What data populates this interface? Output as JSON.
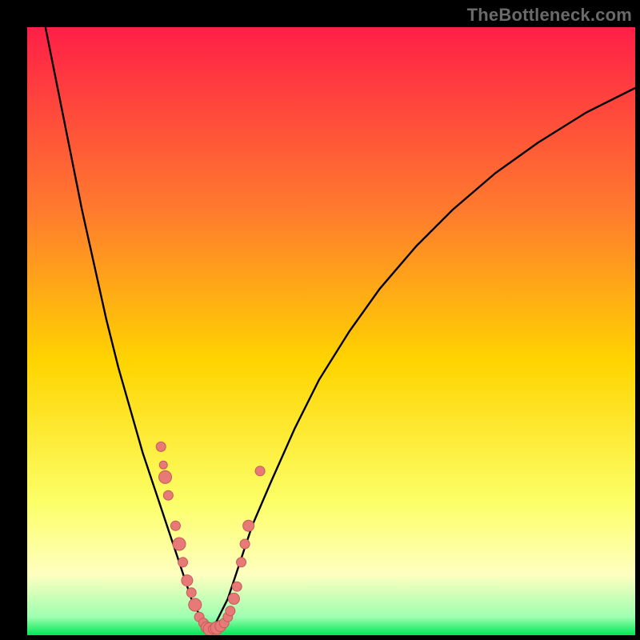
{
  "watermark": "TheBottleneck.com",
  "colors": {
    "frame": "#000000",
    "gradient_top": "#ff1f47",
    "gradient_mid1": "#ff7a2e",
    "gradient_mid2": "#ffd400",
    "gradient_mid3": "#fcff66",
    "gradient_pale": "#ffffc0",
    "gradient_green": "#00e756",
    "curve": "#000000",
    "dot_fill": "#e77a77",
    "dot_stroke": "#c65a5a"
  },
  "chart_data": {
    "type": "line",
    "title": "",
    "xlabel": "",
    "ylabel": "",
    "xlim": [
      0,
      100
    ],
    "ylim": [
      0,
      100
    ],
    "series": [
      {
        "name": "left-branch",
        "x": [
          3,
          5,
          7,
          9,
          11,
          13,
          15,
          17,
          19,
          21,
          22,
          23,
          24,
          25,
          26,
          27,
          28,
          29,
          30
        ],
        "y": [
          100,
          90,
          80,
          70,
          61,
          52,
          44,
          37,
          30,
          24,
          21,
          18,
          15,
          12,
          9,
          6,
          4,
          2,
          1
        ]
      },
      {
        "name": "right-branch",
        "x": [
          30,
          31,
          32,
          33,
          34,
          35,
          37,
          40,
          44,
          48,
          53,
          58,
          64,
          70,
          77,
          84,
          92,
          100
        ],
        "y": [
          1,
          2,
          4,
          6,
          9,
          12,
          18,
          25,
          34,
          42,
          50,
          57,
          64,
          70,
          76,
          81,
          86,
          90
        ]
      }
    ],
    "scatter": [
      {
        "x": 22.0,
        "y": 31,
        "r": 6
      },
      {
        "x": 22.4,
        "y": 28,
        "r": 5
      },
      {
        "x": 22.7,
        "y": 26,
        "r": 8
      },
      {
        "x": 23.2,
        "y": 23,
        "r": 6
      },
      {
        "x": 24.4,
        "y": 18,
        "r": 6
      },
      {
        "x": 25.0,
        "y": 15,
        "r": 8
      },
      {
        "x": 25.6,
        "y": 12,
        "r": 6
      },
      {
        "x": 26.3,
        "y": 9,
        "r": 7
      },
      {
        "x": 27.0,
        "y": 7,
        "r": 6
      },
      {
        "x": 27.6,
        "y": 5,
        "r": 8
      },
      {
        "x": 28.3,
        "y": 3,
        "r": 6
      },
      {
        "x": 29.0,
        "y": 2,
        "r": 6
      },
      {
        "x": 29.5,
        "y": 1.3,
        "r": 7
      },
      {
        "x": 30.0,
        "y": 1,
        "r": 8
      },
      {
        "x": 30.6,
        "y": 1,
        "r": 6
      },
      {
        "x": 31.2,
        "y": 1.2,
        "r": 8
      },
      {
        "x": 31.8,
        "y": 1.5,
        "r": 7
      },
      {
        "x": 32.4,
        "y": 2,
        "r": 6
      },
      {
        "x": 33.0,
        "y": 3,
        "r": 6
      },
      {
        "x": 33.4,
        "y": 4,
        "r": 6
      },
      {
        "x": 34.0,
        "y": 6,
        "r": 7
      },
      {
        "x": 34.5,
        "y": 8,
        "r": 6
      },
      {
        "x": 35.2,
        "y": 12,
        "r": 6
      },
      {
        "x": 35.8,
        "y": 15,
        "r": 6
      },
      {
        "x": 36.4,
        "y": 18,
        "r": 7
      },
      {
        "x": 38.3,
        "y": 27,
        "r": 6
      }
    ]
  }
}
